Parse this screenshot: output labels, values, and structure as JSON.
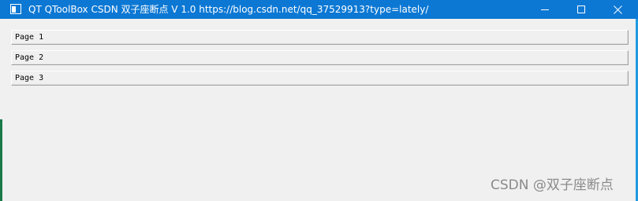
{
  "window": {
    "title": "QT QToolBox  CSDN 双子座断点 V 1.0 https://blog.csdn.net/qq_37529913?type=lately/",
    "controls": {
      "minimize_icon": "minimize-icon",
      "maximize_icon": "maximize-icon",
      "close_icon": "close-icon"
    }
  },
  "toolbox": {
    "pages": [
      {
        "label": "Page 1"
      },
      {
        "label": "Page 2"
      },
      {
        "label": "Page 3"
      }
    ]
  },
  "watermark": "CSDN @双子座断点",
  "colors": {
    "titlebar": "#0c78d4",
    "window_bg": "#f0f0f0",
    "tab_border": "#a0a0a0",
    "watermark": "#8a8a8a"
  }
}
